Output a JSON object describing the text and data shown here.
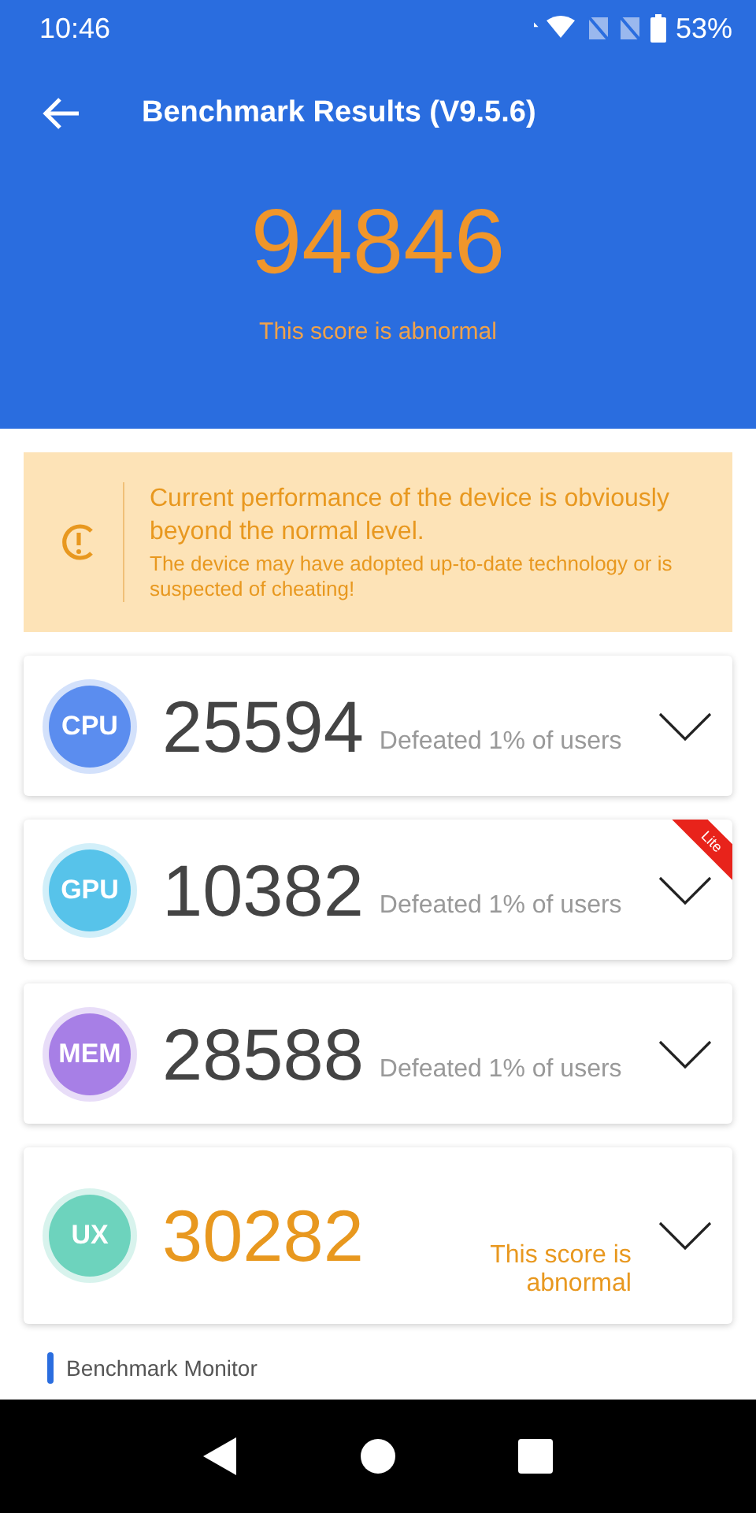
{
  "status_bar": {
    "time": "10:46",
    "battery": "53%"
  },
  "header": {
    "title": "Benchmark Results (V9.5.6)",
    "score": "94846",
    "score_note": "This score is abnormal"
  },
  "warning": {
    "headline": "Current performance of the device is obviously beyond the normal level.",
    "detail": "The device may have adopted up-to-date technology or is suspected of cheating!"
  },
  "results": [
    {
      "label": "CPU",
      "color": "#5b8def",
      "score": "25594",
      "note": "Defeated 1% of users",
      "abnormal": false
    },
    {
      "label": "GPU",
      "color": "#57c3ea",
      "score": "10382",
      "note": "Defeated 1% of users",
      "abnormal": false,
      "ribbon": "Lite"
    },
    {
      "label": "MEM",
      "color": "#a77fe6",
      "score": "28588",
      "note": "Defeated 1% of users",
      "abnormal": false
    },
    {
      "label": "UX",
      "color": "#6dd3bd",
      "score": "30282",
      "note": "This score is abnormal",
      "abnormal": true
    }
  ],
  "section_label": "Benchmark Monitor"
}
